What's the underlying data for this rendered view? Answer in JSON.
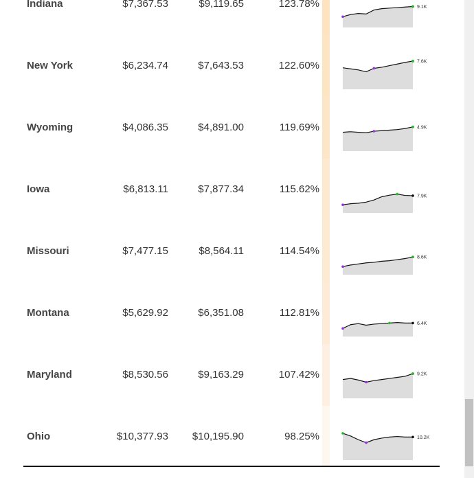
{
  "table": {
    "rows": [
      {
        "state": "Indiana",
        "value1": "$7,367.53",
        "value2": "$9,119.65",
        "percent": "123.78%",
        "bar_color": "#fde3bf",
        "spark_label": "9.1K",
        "trend": [
          0.3,
          0.38,
          0.42,
          0.4,
          0.55,
          0.6,
          0.62,
          0.64,
          0.66,
          0.68
        ],
        "low_index": 0,
        "high_index": 9
      },
      {
        "state": "New York",
        "value1": "$6,234.74",
        "value2": "$7,643.53",
        "percent": "122.60%",
        "bar_color": "#fde4c2",
        "spark_label": "7.6K",
        "trend": [
          0.7,
          0.66,
          0.62,
          0.55,
          0.68,
          0.72,
          0.78,
          0.84,
          0.9,
          0.95
        ],
        "low_index": 4,
        "high_index": 9
      },
      {
        "state": "Wyoming",
        "value1": "$4,086.35",
        "value2": "$4,891.00",
        "percent": "119.69%",
        "bar_color": "#fde6c8",
        "spark_label": "4.9K",
        "trend": [
          0.6,
          0.62,
          0.6,
          0.58,
          0.64,
          0.66,
          0.68,
          0.7,
          0.74,
          0.8
        ],
        "low_index": 4,
        "high_index": 9
      },
      {
        "state": "Iowa",
        "value1": "$6,813.11",
        "value2": "$7,877.34",
        "percent": "115.62%",
        "bar_color": "#fde9cf",
        "spark_label": "7.9K",
        "trend": [
          0.2,
          0.24,
          0.26,
          0.3,
          0.38,
          0.5,
          0.56,
          0.6,
          0.55,
          0.54
        ],
        "low_index": 0,
        "high_index": 7
      },
      {
        "state": "Missouri",
        "value1": "$7,477.15",
        "value2": "$8,564.11",
        "percent": "114.54%",
        "bar_color": "#fdead3",
        "spark_label": "8.6K",
        "trend": [
          0.2,
          0.26,
          0.3,
          0.34,
          0.36,
          0.4,
          0.42,
          0.46,
          0.5,
          0.56
        ],
        "low_index": 0,
        "high_index": 9
      },
      {
        "state": "Montana",
        "value1": "$5,629.92",
        "value2": "$6,351.08",
        "percent": "112.81%",
        "bar_color": "#fdebd7",
        "spark_label": "6.4K",
        "trend": [
          0.2,
          0.34,
          0.38,
          0.32,
          0.36,
          0.38,
          0.4,
          0.42,
          0.4,
          0.4
        ],
        "low_index": 0,
        "high_index": 6
      },
      {
        "state": "Maryland",
        "value1": "$8,530.56",
        "value2": "$9,163.29",
        "percent": "107.42%",
        "bar_color": "#fdf0e2",
        "spark_label": "9.2K",
        "trend": [
          0.6,
          0.64,
          0.58,
          0.5,
          0.56,
          0.6,
          0.64,
          0.68,
          0.72,
          0.82
        ],
        "low_index": 3,
        "high_index": 9
      },
      {
        "state": "Ohio",
        "value1": "$10,377.93",
        "value2": "$10,195.90",
        "percent": "98.25%",
        "bar_color": "#fef7ef",
        "spark_label": "10.2K",
        "trend": [
          0.9,
          0.8,
          0.66,
          0.55,
          0.66,
          0.72,
          0.76,
          0.78,
          0.76,
          0.76
        ],
        "low_index": 3,
        "high_index": 0
      }
    ]
  },
  "colors": {
    "spark_fill": "#dddddd",
    "spark_line": "#111111",
    "low_marker": "#9a2ee0",
    "high_marker": "#22c022",
    "end_marker": "#111111"
  }
}
